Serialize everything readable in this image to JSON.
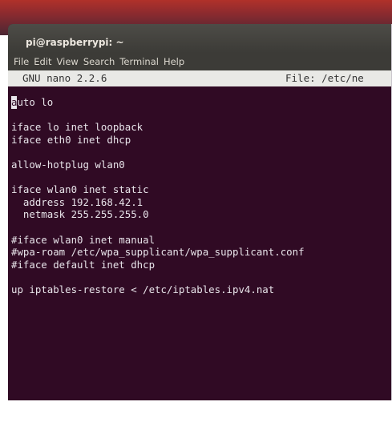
{
  "window": {
    "title": "pi@raspberrypi: ~"
  },
  "menubar": {
    "items": [
      "File",
      "Edit",
      "View",
      "Search",
      "Terminal",
      "Help"
    ]
  },
  "nano": {
    "version": "GNU nano 2.2.6",
    "file": "File: /etc/ne"
  },
  "editor": {
    "cursor_char": "a",
    "lines": [
      "uto lo",
      "",
      "iface lo inet loopback",
      "iface eth0 inet dhcp",
      "",
      "allow-hotplug wlan0",
      "",
      "iface wlan0 inet static",
      "  address 192.168.42.1",
      "  netmask 255.255.255.0",
      "",
      "#iface wlan0 inet manual",
      "#wpa-roam /etc/wpa_supplicant/wpa_supplicant.conf",
      "#iface default inet dhcp",
      "",
      "up iptables-restore < /etc/iptables.ipv4.nat"
    ]
  },
  "colors": {
    "terminal_bg": "#300a24",
    "terminal_fg": "#e8e4ea",
    "titlebar": "#3c3b37",
    "nano_header_bg": "#e9e9e6"
  }
}
